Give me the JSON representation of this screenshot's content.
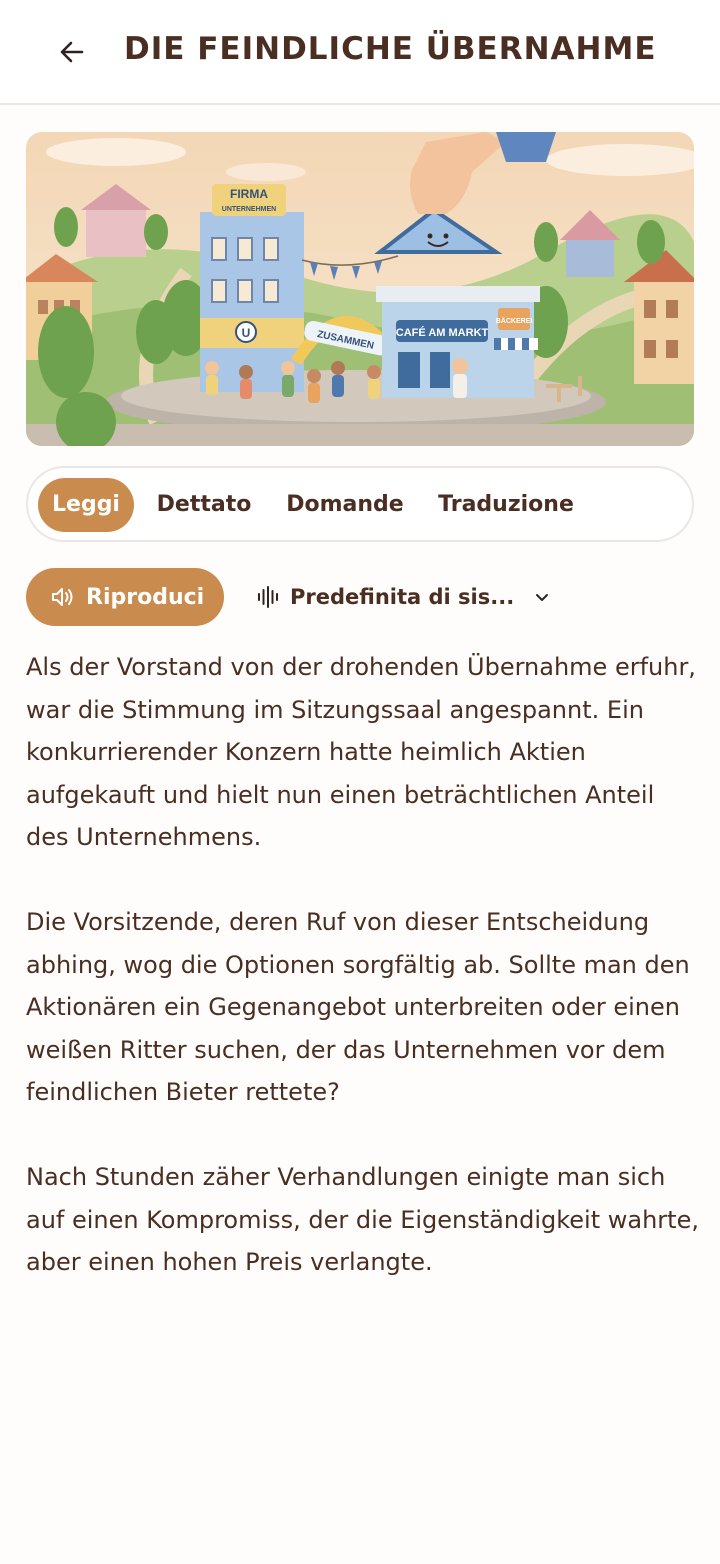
{
  "header": {
    "title": "DIE FEINDLICHE ÜBERNAHME",
    "back_icon": "arrow-left-icon"
  },
  "hero": {
    "sign_firma": "FIRMA",
    "sign_unternehmen": "UNTERNEHMEN",
    "sign_cafe": "CAFÉ AM MARKT",
    "sign_baeckerei": "BÄCKEREI",
    "banner": "ZUSAMMEN",
    "logo_letter": "U"
  },
  "tabs": [
    {
      "label": "Leggi",
      "active": true
    },
    {
      "label": "Dettato",
      "active": false
    },
    {
      "label": "Domande",
      "active": false
    },
    {
      "label": "Traduzione",
      "active": false
    }
  ],
  "player": {
    "play_label": "Riproduci",
    "play_icon": "speaker-icon",
    "voice_label": "Predefinita di sis...",
    "voice_icon": "waveform-icon",
    "voice_chevron_icon": "chevron-down-icon"
  },
  "paragraphs": [
    "Als der Vorstand von der drohenden Übernahme erfuhr, war die Stimmung im Sitzungssaal angespannt. Ein konkurrierender Konzern hatte heimlich Aktien aufgekauft und hielt nun einen beträchtlichen Anteil des Unternehmens.",
    "Die Vorsitzende, deren Ruf von dieser Entscheidung abhing, wog die Optionen sorgfältig ab. Sollte man den Aktionären ein Gegenangebot unterbreiten oder einen weißen Ritter suchen, der das Unternehmen vor dem feindlichen Bieter rettete?",
    "Nach Stunden zäher Verhandlungen einigte man sich auf einen Kompromiss, der die Eigenständigkeit wahrte, aber einen hohen Preis verlangte."
  ],
  "colors": {
    "accent": "#c98b4e",
    "text": "#4a2e22",
    "border": "#ece6e3",
    "background": "#fffdfc"
  }
}
